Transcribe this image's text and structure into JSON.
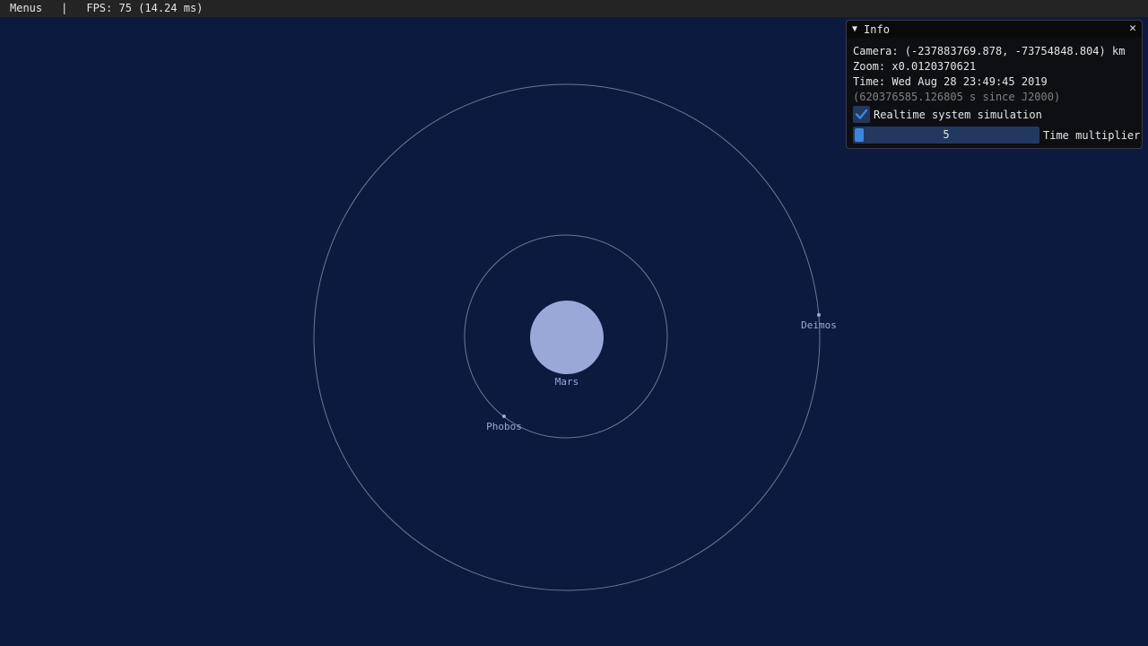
{
  "menubar": {
    "menus_label": "Menus",
    "separator": "|",
    "fps_text": "FPS: 75 (14.24 ms)"
  },
  "info": {
    "collapse_glyph": "▼",
    "title": "Info",
    "close_glyph": "✕",
    "camera": "Camera: (-237883769.878, -73754848.804) km",
    "zoom": "Zoom: x0.0120370621",
    "time": "Time: Wed Aug 28 23:49:45 2019",
    "since_j2000": "(620376585.126805 s since J2000)",
    "realtime_label": "Realtime system simulation",
    "realtime_checked": true,
    "time_multiplier_value": "5",
    "time_multiplier_label": "Time multiplier"
  },
  "bodies": {
    "planet": "Mars",
    "moon_inner": "Phobos",
    "moon_outer": "Deimos"
  },
  "colors": {
    "background": "#0d1a40",
    "planet": "#9aa8d8",
    "orbit": "#6f7690",
    "label": "#9aa8d8",
    "accent": "#3d85e0"
  }
}
